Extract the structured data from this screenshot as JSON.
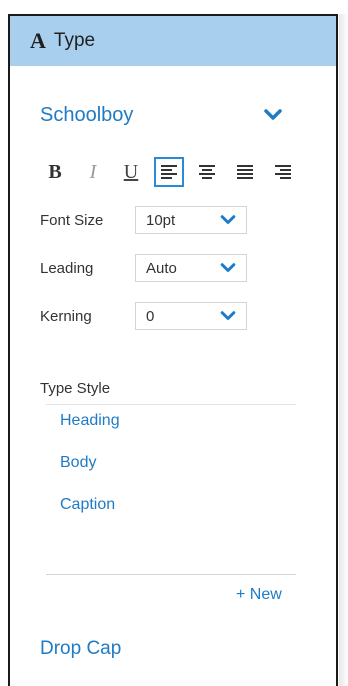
{
  "panel": {
    "icon_glyph": "A",
    "title": "Type"
  },
  "font": {
    "name": "Schoolboy"
  },
  "format_buttons": [
    {
      "label": "B",
      "name": "bold-button"
    },
    {
      "label": "I",
      "name": "italic-button"
    },
    {
      "label": "U",
      "name": "underline-button"
    }
  ],
  "alignment": {
    "active": "left"
  },
  "properties": {
    "font_size": {
      "label": "Font Size",
      "value": "10pt"
    },
    "leading": {
      "label": "Leading",
      "value": "Auto"
    },
    "kerning": {
      "label": "Kerning",
      "value": "0"
    }
  },
  "type_style": {
    "label": "Type Style",
    "items": [
      "Heading",
      "Body",
      "Caption"
    ],
    "new_label": "+ New"
  },
  "drop_cap": {
    "label": "Drop Cap"
  },
  "colors": {
    "header_bg": "#a9cfee",
    "accent": "#1f7bc6",
    "active_border": "#2a8ad6"
  }
}
